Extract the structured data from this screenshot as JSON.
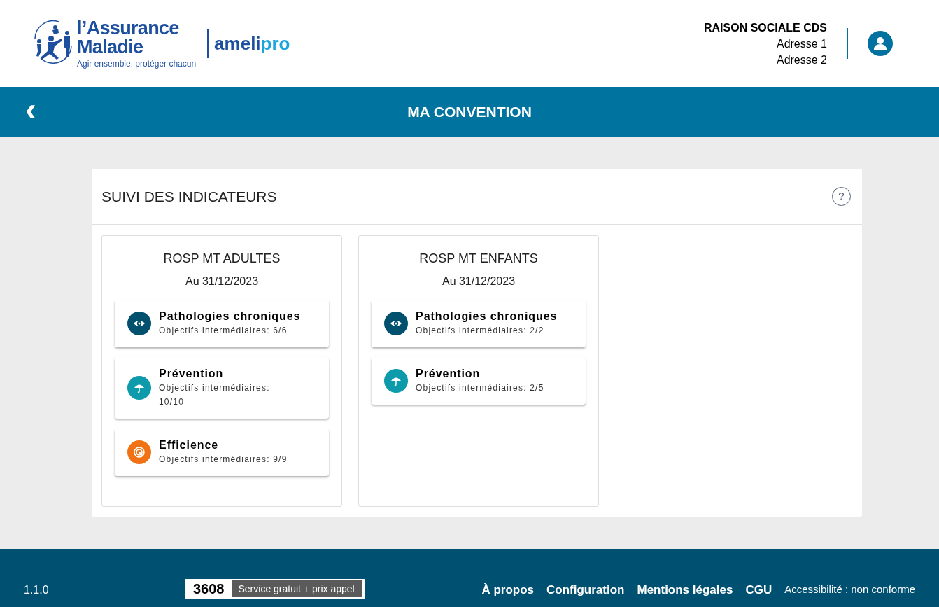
{
  "header": {
    "logo": {
      "name_line1": "l’Assurance",
      "name_line2": "Maladie",
      "tagline": "Agir ensemble, protéger chacun",
      "product": "ameli",
      "product_suffix": "pro"
    },
    "account": {
      "name": "RAISON SOCIALE CDS",
      "address_lines": [
        "Adresse 1",
        "Adresse 2"
      ]
    }
  },
  "title_bar": {
    "back": "‹",
    "title": "MA CONVENTION"
  },
  "panel": {
    "title": "SUIVI DES INDICATEURS",
    "help": "?",
    "cards": [
      {
        "title": "ROSP MT ADULTES",
        "date": "Au 31/12/2023",
        "items": [
          {
            "kind": "eye",
            "color": "#00506e",
            "title": "Pathologies chroniques",
            "detail": "Objectifs intermédiaires: 6/6"
          },
          {
            "kind": "umbrella",
            "color": "#0d9aaa",
            "title": "Prévention",
            "detail": "Objectifs intermédiaires: 10/10"
          },
          {
            "kind": "target",
            "color": "#f07214",
            "title": "Efficience",
            "detail": "Objectifs intermédiaires: 9/9"
          }
        ]
      },
      {
        "title": "ROSP MT ENFANTS",
        "date": "Au 31/12/2023",
        "items": [
          {
            "kind": "eye",
            "color": "#00506e",
            "title": "Pathologies chroniques",
            "detail": "Objectifs intermédiaires: 2/2"
          },
          {
            "kind": "umbrella",
            "color": "#0d9aaa",
            "title": "Prévention",
            "detail": "Objectifs intermédiaires: 2/5"
          }
        ]
      }
    ]
  },
  "footer": {
    "version": "1.1.0",
    "phone": {
      "number": "3608",
      "note": "Service gratuit + prix appel"
    },
    "links": [
      "À propos",
      "Configuration",
      "Mentions légales",
      "CGU"
    ],
    "accessibility": "Accessibilité : non conforme"
  }
}
